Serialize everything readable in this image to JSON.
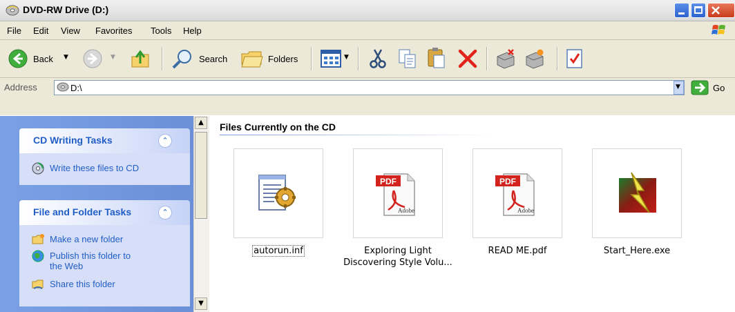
{
  "window": {
    "title": "DVD-RW Drive (D:)"
  },
  "menu": [
    "File",
    "Edit",
    "View",
    "Favorites",
    "Tools",
    "Help"
  ],
  "toolbar": {
    "back_label": "Back",
    "search_label": "Search",
    "folders_label": "Folders"
  },
  "address": {
    "label": "Address",
    "value": "D:\\",
    "go_label": "Go"
  },
  "tasks": {
    "cd_writing": {
      "title": "CD Writing Tasks",
      "items": [
        "Write these files to CD"
      ]
    },
    "file_folder": {
      "title": "File and Folder Tasks",
      "items": [
        "Make a new folder",
        "Publish this folder to\nthe Web",
        "Share this folder"
      ]
    }
  },
  "content": {
    "group_header": "Files Currently on the CD",
    "files": [
      {
        "name": "autorun.inf",
        "icon": "inf-settings-icon"
      },
      {
        "name": "Exploring Light\nDiscovering Style Volu...",
        "icon": "pdf-icon"
      },
      {
        "name": "READ ME.pdf",
        "icon": "pdf-icon"
      },
      {
        "name": "Start_Here.exe",
        "icon": "exe-lightning-icon"
      }
    ]
  },
  "colors": {
    "task_text": "#215dc6",
    "left_pane": "#7aa1e6",
    "chrome": "#ece9d8"
  }
}
